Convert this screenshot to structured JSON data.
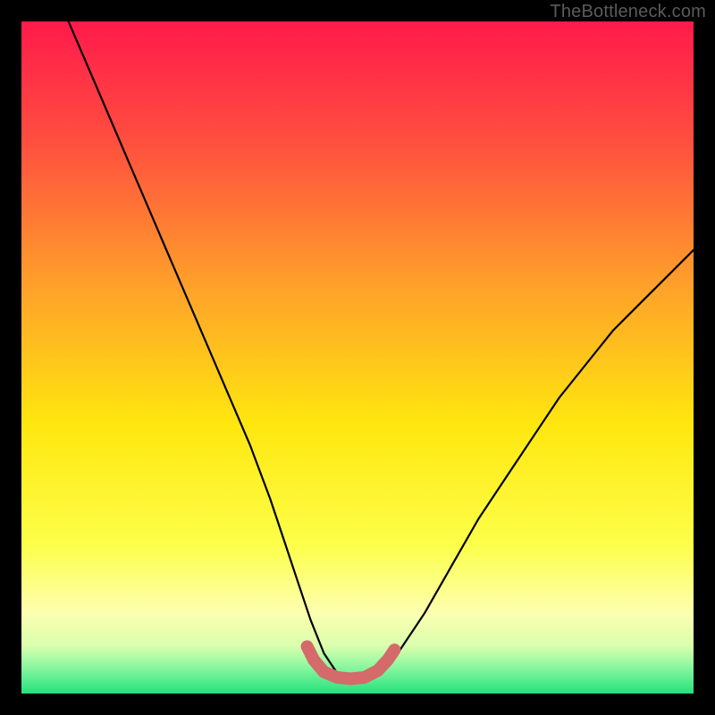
{
  "watermark": "TheBottleneck.com",
  "chart_data": {
    "type": "line",
    "title": "",
    "xlabel": "",
    "ylabel": "",
    "xlim": [
      0,
      100
    ],
    "ylim": [
      0,
      100
    ],
    "grid": false,
    "legend": false,
    "background_gradient_stops": [
      {
        "offset": 0.0,
        "color": "#ff1a4b"
      },
      {
        "offset": 0.18,
        "color": "#ff4f3f"
      },
      {
        "offset": 0.4,
        "color": "#ffa329"
      },
      {
        "offset": 0.6,
        "color": "#ffe70f"
      },
      {
        "offset": 0.78,
        "color": "#fcff4a"
      },
      {
        "offset": 0.88,
        "color": "#fdffb0"
      },
      {
        "offset": 0.93,
        "color": "#d9ffad"
      },
      {
        "offset": 0.96,
        "color": "#8cf7a0"
      },
      {
        "offset": 1.0,
        "color": "#23e27d"
      }
    ],
    "series": [
      {
        "name": "bottleneck-curve",
        "x": [
          7,
          10,
          13,
          16,
          19,
          22,
          25,
          28,
          31,
          34,
          37,
          39,
          41,
          43,
          45,
          47,
          49,
          51,
          53,
          56,
          60,
          64,
          68,
          72,
          76,
          80,
          84,
          88,
          92,
          96,
          100
        ],
        "y": [
          100,
          93,
          86,
          79,
          72,
          65,
          58,
          51,
          44,
          37,
          29,
          23,
          17,
          11,
          6,
          3,
          2,
          2,
          3,
          6,
          12,
          19,
          26,
          32,
          38,
          44,
          49,
          54,
          58,
          62,
          66
        ]
      }
    ],
    "markers": {
      "name": "valley-markers",
      "color": "#d46a6a",
      "points": [
        {
          "x": 42.5,
          "y": 7.0
        },
        {
          "x": 43.5,
          "y": 5.0
        },
        {
          "x": 45.0,
          "y": 3.2
        },
        {
          "x": 47.0,
          "y": 2.4
        },
        {
          "x": 49.0,
          "y": 2.2
        },
        {
          "x": 51.0,
          "y": 2.4
        },
        {
          "x": 53.0,
          "y": 3.4
        },
        {
          "x": 54.5,
          "y": 5.0
        },
        {
          "x": 55.5,
          "y": 6.5
        }
      ]
    }
  }
}
